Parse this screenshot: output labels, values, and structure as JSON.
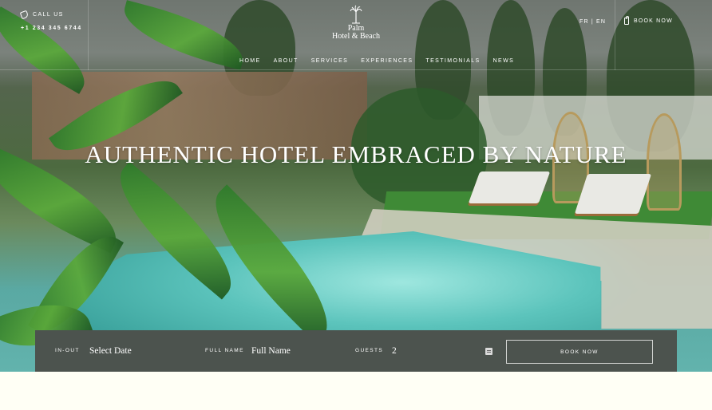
{
  "header": {
    "call_label": "CALL US",
    "phone": "+1 234 345 6744",
    "logo_line1": "Palm",
    "logo_line2": "Hotel & Beach",
    "lang": "FR | EN",
    "book_now": "BOOK NOW"
  },
  "nav": {
    "items": [
      "HOME",
      "ABOUT",
      "SERVICES",
      "EXPERIENCES",
      "TESTIMONIALS",
      "NEWS"
    ]
  },
  "hero": {
    "headline": "AUTHENTIC HOTEL EMBRACED BY NATURE"
  },
  "booking": {
    "inout_label": "IN-OUT",
    "date_placeholder": "Select Date",
    "name_label": "FULL NAME",
    "name_placeholder": "Full Name",
    "guests_label": "GUESTS",
    "guests_value": "2",
    "book_button": "BOOK NOW"
  },
  "icons": {
    "phone": "phone-icon",
    "logo": "palm-tree-icon",
    "book": "bag-icon",
    "stepper": "stepper-icon"
  },
  "colors": {
    "booking_bar": "#4c534e",
    "page_background": "#fffff5",
    "text": "#ffffff"
  }
}
